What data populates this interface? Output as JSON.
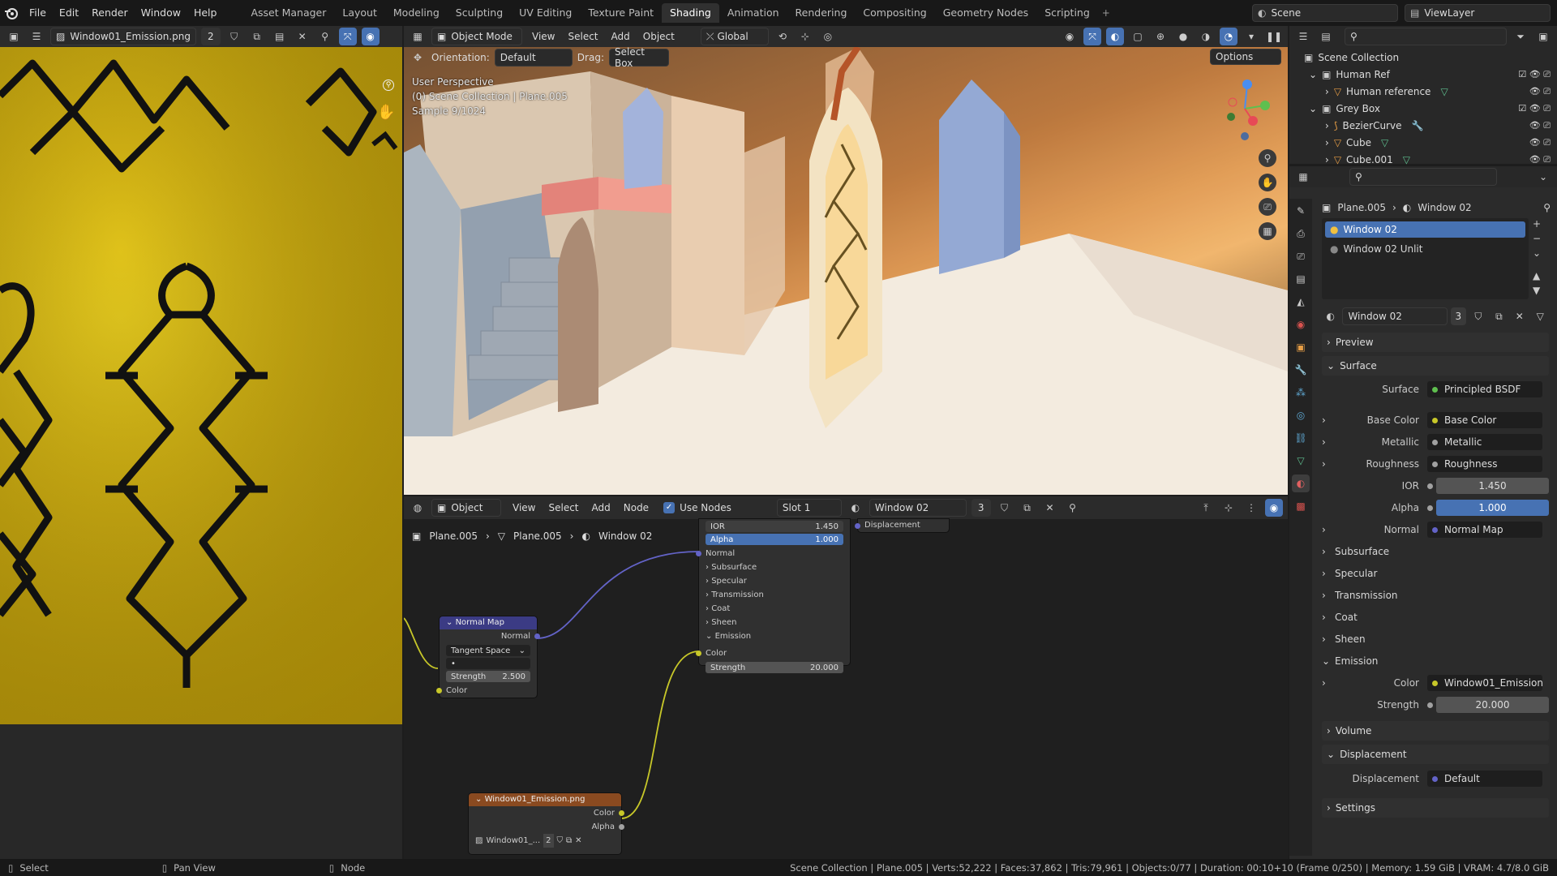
{
  "topbar": {
    "menus": [
      "File",
      "Edit",
      "Render",
      "Window",
      "Help"
    ],
    "workspaces": [
      "Asset Manager",
      "Layout",
      "Modeling",
      "Sculpting",
      "UV Editing",
      "Texture Paint",
      "Shading",
      "Animation",
      "Rendering",
      "Compositing",
      "Geometry Nodes",
      "Scripting"
    ],
    "active_workspace": "Shading",
    "plus": "+",
    "scene_label": "Scene",
    "viewlayer_label": "ViewLayer"
  },
  "image_editor": {
    "image_name": "Window01_Emission.png",
    "users": "2"
  },
  "viewport": {
    "mode": "Object Mode",
    "menus": [
      "View",
      "Select",
      "Add",
      "Object"
    ],
    "transform": "Global",
    "orientation_label": "Orientation:",
    "orientation_value": "Default",
    "drag_label": "Drag:",
    "drag_value": "Select Box",
    "options": "Options",
    "overlay_line1": "User Perspective",
    "overlay_line2": "(0) Scene Collection | Plane.005",
    "overlay_line3": "Sample 9/1024"
  },
  "node_editor": {
    "type": "Object",
    "menus": [
      "View",
      "Select",
      "Add",
      "Node"
    ],
    "use_nodes_label": "Use Nodes",
    "slot": "Slot 1",
    "material": "Window 02",
    "users": "3",
    "breadcrumb": [
      "Plane.005",
      "Plane.005",
      "Window 02"
    ],
    "bsdf": {
      "ior_label": "IOR",
      "ior_value": "1.450",
      "alpha_label": "Alpha",
      "alpha_value": "1.000",
      "normal": "Normal",
      "panels": [
        "Subsurface",
        "Specular",
        "Transmission",
        "Coat",
        "Sheen",
        "Emission"
      ],
      "color": "Color",
      "strength_label": "Strength",
      "strength_value": "20.000"
    },
    "output_displacement": "Displacement",
    "normal_map": {
      "title": "Normal Map",
      "out": "Normal",
      "space": "Tangent Space",
      "strength_label": "Strength",
      "strength_value": "2.500",
      "color": "Color"
    },
    "image_node": {
      "title": "Window01_Emission.png",
      "color": "Color",
      "alpha": "Alpha",
      "image_name": "Window01_...",
      "users": "2"
    }
  },
  "outliner": {
    "rows": [
      {
        "label": "Scene Collection",
        "indent": 0
      },
      {
        "label": "Human Ref",
        "indent": 1
      },
      {
        "label": "Human reference",
        "indent": 2
      },
      {
        "label": "Grey Box",
        "indent": 1
      },
      {
        "label": "BezierCurve",
        "indent": 2
      },
      {
        "label": "Cube",
        "indent": 2
      },
      {
        "label": "Cube.001",
        "indent": 2
      }
    ]
  },
  "properties": {
    "breadcrumb_object": "Plane.005",
    "breadcrumb_material": "Window 02",
    "slots": [
      "Window 02",
      "Window 02 Unlit"
    ],
    "material_name": "Window 02",
    "material_users": "3",
    "sections": {
      "preview": "Preview",
      "surface": "Surface",
      "volume": "Volume",
      "displacement": "Displacement",
      "settings": "Settings"
    },
    "surface_label": "Surface",
    "surface_value": "Principled BSDF",
    "rows": {
      "base_color_label": "Base Color",
      "base_color_value": "Base Color",
      "metallic_label": "Metallic",
      "metallic_value": "Metallic",
      "roughness_label": "Roughness",
      "roughness_value": "Roughness",
      "ior_label": "IOR",
      "ior_value": "1.450",
      "alpha_label": "Alpha",
      "alpha_value": "1.000",
      "normal_label": "Normal",
      "normal_value": "Normal Map",
      "subsurface": "Subsurface",
      "specular": "Specular",
      "transmission": "Transmission",
      "coat": "Coat",
      "sheen": "Sheen",
      "emission": "Emission",
      "color_label": "Color",
      "color_value": "Window01_Emission....",
      "strength_label": "Strength",
      "strength_value": "20.000",
      "displacement_label": "Displacement",
      "displacement_value": "Default"
    }
  },
  "statusbar": {
    "select": "Select",
    "pan": "Pan View",
    "node": "Node",
    "info": "Scene Collection | Plane.005 | Verts:52,222 | Faces:37,862 | Tris:79,961 | Objects:0/77 | Duration: 00:10+10 (Frame 0/250) | Memory: 1.59 GiB | VRAM: 4.7/8.0 GiB"
  },
  "colors": {
    "accent": "#4772b3",
    "socket_yellow": "#c7c729",
    "socket_purple": "#6363c7",
    "socket_gray": "#a1a1a1",
    "image_node_header": "#8a4a20",
    "normal_map_header": "#3b3b84"
  }
}
